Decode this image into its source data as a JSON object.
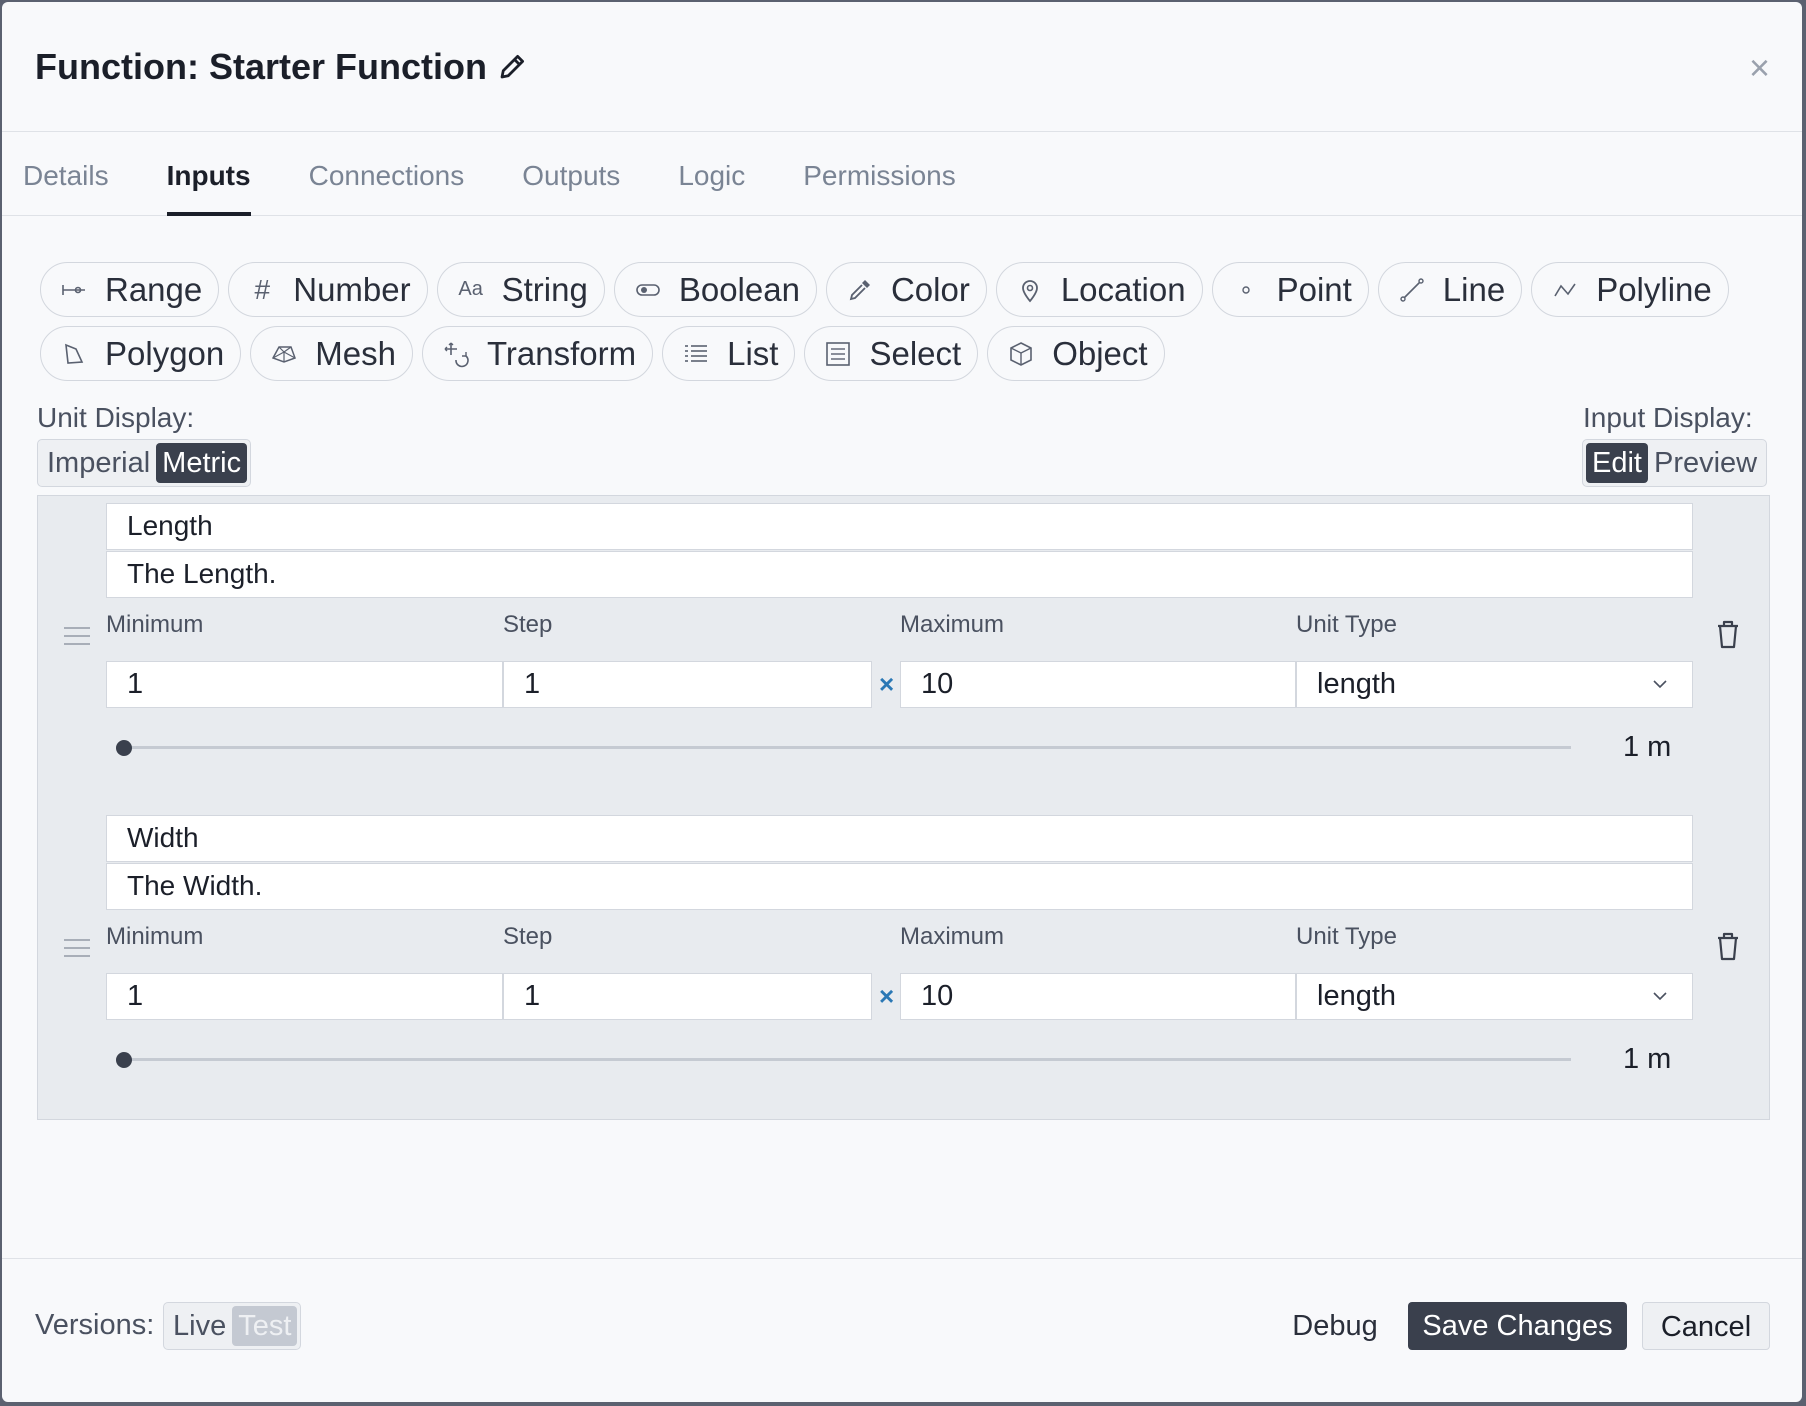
{
  "header": {
    "title": "Function: Starter Function"
  },
  "tabs": [
    {
      "label": "Details"
    },
    {
      "label": "Inputs",
      "active": true
    },
    {
      "label": "Connections"
    },
    {
      "label": "Outputs"
    },
    {
      "label": "Logic"
    },
    {
      "label": "Permissions"
    }
  ],
  "input_types": [
    {
      "label": "Range",
      "icon": "range-icon"
    },
    {
      "label": "Number",
      "icon": "hash-icon"
    },
    {
      "label": "String",
      "icon": "text-aa-icon"
    },
    {
      "label": "Boolean",
      "icon": "toggle-icon"
    },
    {
      "label": "Color",
      "icon": "eyedropper-icon"
    },
    {
      "label": "Location",
      "icon": "map-pin-icon"
    },
    {
      "label": "Point",
      "icon": "point-icon"
    },
    {
      "label": "Line",
      "icon": "line-icon"
    },
    {
      "label": "Polyline",
      "icon": "polyline-icon"
    },
    {
      "label": "Polygon",
      "icon": "polygon-icon"
    },
    {
      "label": "Mesh",
      "icon": "mesh-icon"
    },
    {
      "label": "Transform",
      "icon": "transform-icon"
    },
    {
      "label": "List",
      "icon": "list-icon"
    },
    {
      "label": "Select",
      "icon": "select-icon"
    },
    {
      "label": "Object",
      "icon": "cube-icon"
    }
  ],
  "unit_display": {
    "label": "Unit Display:",
    "options": [
      "Imperial",
      "Metric"
    ],
    "selected": "Metric"
  },
  "input_display": {
    "label": "Input Display:",
    "options": [
      "Edit",
      "Preview"
    ],
    "selected": "Edit"
  },
  "inputs": [
    {
      "name": "Length",
      "description": "The Length.",
      "min_label": "Minimum",
      "step_label": "Step",
      "max_label": "Maximum",
      "unit_label": "Unit Type",
      "minimum": "1",
      "step": "1",
      "maximum": "10",
      "unit_type": "length",
      "clear": "×",
      "value_display": "1 m",
      "slider_fraction": 0
    },
    {
      "name": "Width",
      "description": "The Width.",
      "min_label": "Minimum",
      "step_label": "Step",
      "max_label": "Maximum",
      "unit_label": "Unit Type",
      "minimum": "1",
      "step": "1",
      "maximum": "10",
      "unit_type": "length",
      "clear": "×",
      "value_display": "1 m",
      "slider_fraction": 0
    }
  ],
  "footer": {
    "versions_label": "Versions:",
    "versions": [
      "Live",
      "Test"
    ],
    "debug": "Debug",
    "save": "Save Changes",
    "cancel": "Cancel"
  }
}
